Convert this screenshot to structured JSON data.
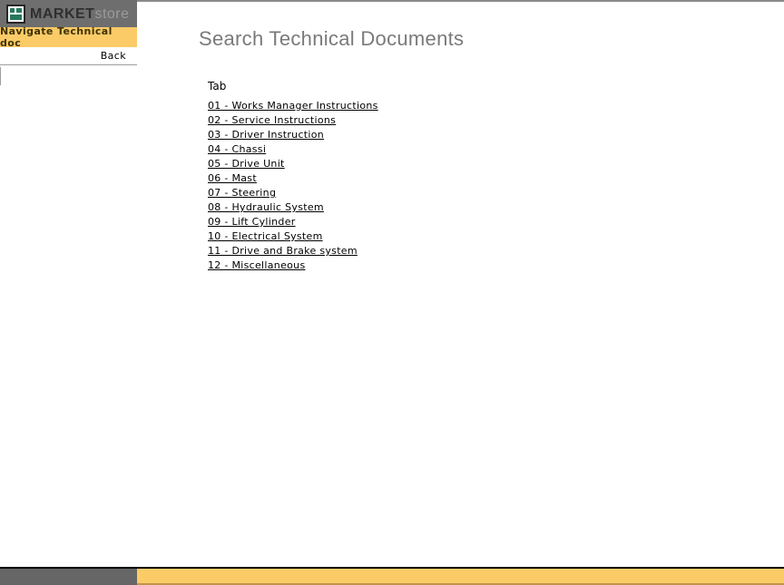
{
  "brand": {
    "name_primary": "MARKET",
    "name_secondary": "store",
    "logo_icon": "grid-tiles-icon"
  },
  "sidebar": {
    "nav_title": "Navigate Technical doc",
    "back_label": "Back",
    "search_value": "",
    "search_placeholder": ""
  },
  "main": {
    "title": "Search Technical Documents",
    "column_header": "Tab",
    "links": [
      {
        "label": "01 - Works Manager Instructions"
      },
      {
        "label": "02 - Service Instructions"
      },
      {
        "label": "03 - Driver Instruction"
      },
      {
        "label": "04 - Chassi"
      },
      {
        "label": "05 - Drive Unit"
      },
      {
        "label": "06 - Mast"
      },
      {
        "label": "07 - Steering"
      },
      {
        "label": "08 - Hydraulic System"
      },
      {
        "label": "09 - Lift Cylinder"
      },
      {
        "label": "10 - Electrical System"
      },
      {
        "label": "11 - Drive and Brake system"
      },
      {
        "label": "12 - Miscellaneous"
      }
    ]
  },
  "colors": {
    "header_gray": "#6E6E6E",
    "accent_yellow": "#FBCB68",
    "footer_gray": "#666666",
    "footer_yellow_edge": "#C1954A",
    "title_gray": "#7A7A7A",
    "icon_green": "#27795B"
  }
}
